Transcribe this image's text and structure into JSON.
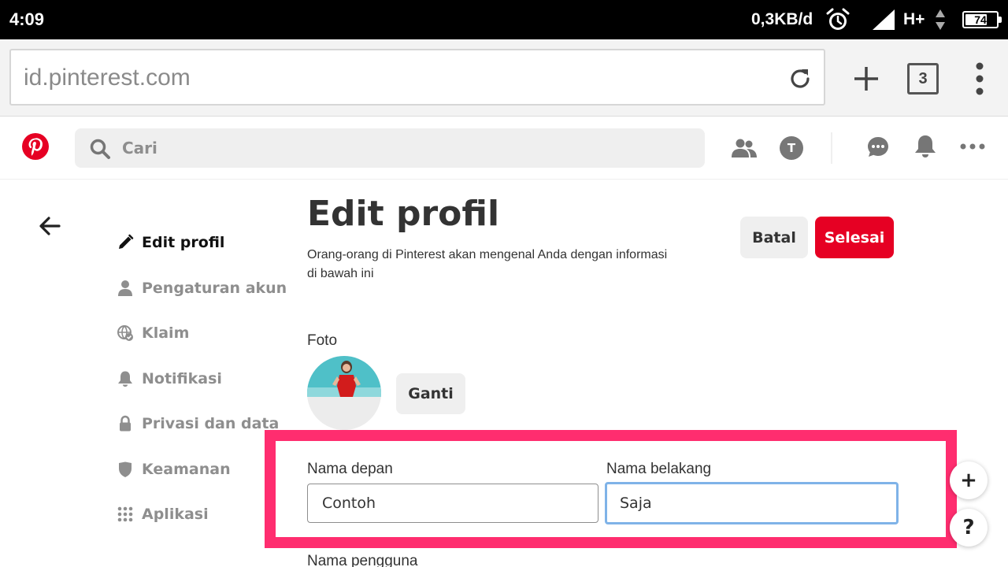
{
  "status_bar": {
    "time": "4:09",
    "speed": "0,3KB/d",
    "network": "H+",
    "battery": 74,
    "battery_label": "74"
  },
  "browser": {
    "url": "id.pinterest.com",
    "tab_count": "3"
  },
  "header": {
    "search_placeholder": "Cari",
    "avatar_initial": "T",
    "brand_color": "#e60023"
  },
  "sidebar": {
    "items": [
      {
        "label": "Edit profil",
        "icon": "pencil-icon",
        "active": true
      },
      {
        "label": "Pengaturan akun",
        "icon": "person-icon",
        "active": false
      },
      {
        "label": "Klaim",
        "icon": "globe-check-icon",
        "active": false
      },
      {
        "label": "Notifikasi",
        "icon": "bell-icon",
        "active": false
      },
      {
        "label": "Privasi dan data",
        "icon": "lock-icon",
        "active": false
      },
      {
        "label": "Keamanan",
        "icon": "shield-icon",
        "active": false
      },
      {
        "label": "Aplikasi",
        "icon": "grid-icon",
        "active": false
      }
    ]
  },
  "main": {
    "title": "Edit profil",
    "subtitle": "Orang-orang di Pinterest akan mengenal Anda dengan informasi di bawah ini",
    "cancel_label": "Batal",
    "done_label": "Selesai",
    "photo_label": "Foto",
    "change_label": "Ganti",
    "first_name_label": "Nama depan",
    "first_name_value": "Contoh",
    "last_name_label": "Nama belakang",
    "last_name_value": "Saja",
    "username_label": "Nama pengguna"
  },
  "floating": {
    "add_label": "+",
    "help_label": "?"
  },
  "highlight_color": "#ff2d6f"
}
